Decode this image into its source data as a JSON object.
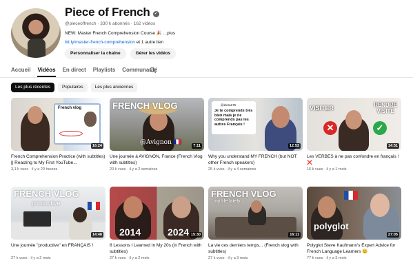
{
  "channel": {
    "name": "Piece of French",
    "handle": "@pieceoffrench",
    "subscribers": "330 k abonnés",
    "videos_count": "162 vidéos",
    "description": "NEW: Master French Comprehension Course 🎉 ...",
    "more_label": "plus",
    "link_url": "bit.ly/master-french-comprehension",
    "link_more": "et 1 autre lien",
    "customize_label": "Personnaliser la chaîne",
    "manage_label": "Gérer les vidéos"
  },
  "tabs": [
    {
      "label": "Accueil",
      "active": false
    },
    {
      "label": "Vidéos",
      "active": true
    },
    {
      "label": "En direct",
      "active": false
    },
    {
      "label": "Playlists",
      "active": false
    },
    {
      "label": "Communauté",
      "active": false
    }
  ],
  "chips": [
    {
      "label": "Les plus récentes",
      "active": true
    },
    {
      "label": "Populaires",
      "active": false
    },
    {
      "label": "Les plus anciennes",
      "active": false
    }
  ],
  "videos": [
    {
      "title": "French Comprehension Practice (with subtitles) || Reacting to My First YouTube...",
      "views": "3,1 k vues",
      "age": "il y a 20 heures",
      "duration": "16:24",
      "overlay": "French vlog"
    },
    {
      "title": "Une journée à AVIGNON, France (French Vlog with subtitles)",
      "views": "20 k vues",
      "age": "il y a 2 semaines",
      "duration": "7:11",
      "overlay": "FRENCH VLOG",
      "overlay2": "@Avignon 🇫🇷"
    },
    {
      "title": "Why you understand MY FRENCH (but NOT other French speakers)",
      "views": "25 k vues",
      "age": "il y a 4 semaines",
      "duration": "12:53",
      "overlay": "Je te comprends très bien mais je ne comprends pas les autres Français !",
      "overlay2": "@elera175"
    },
    {
      "title": "Les VERBES à ne pas confondre en français ! ❌",
      "views": "16 k vues",
      "age": "il y a 1 mois",
      "duration": "14:51",
      "overlay": "VISITER",
      "overlay2": "RENDRE VISITE"
    },
    {
      "title": "Une journée \"productive\" en FRANÇAIS !",
      "views": "27 k vues",
      "age": "il y a 2 mois",
      "duration": "14:48",
      "overlay": "FRENCH VLOG",
      "overlay2": "productive"
    },
    {
      "title": "8 Lessons I Learned In My 20s (in French with subtitles)",
      "views": "27 k vues",
      "age": "il y a 2 mois",
      "duration": "15:30",
      "overlay": "2014",
      "overlay2": "2024"
    },
    {
      "title": "La vie ces derniers temps... (French vlog with subtitles)",
      "views": "27 k vues",
      "age": "il y a 3 mois",
      "duration": "16:11",
      "overlay": "FRENCH VLOG",
      "overlay2": "my life lately"
    },
    {
      "title": "Polyglot Steve Kaufmann's Expert Advice for French Language Learners 😊",
      "views": "77 k vues",
      "age": "il y a 3 mois",
      "duration": "27:05",
      "overlay": "polyglot"
    }
  ],
  "colors": {
    "accent": "#065fd4",
    "chip_active": "#0f0f0f",
    "chip": "#f2f2f2"
  }
}
